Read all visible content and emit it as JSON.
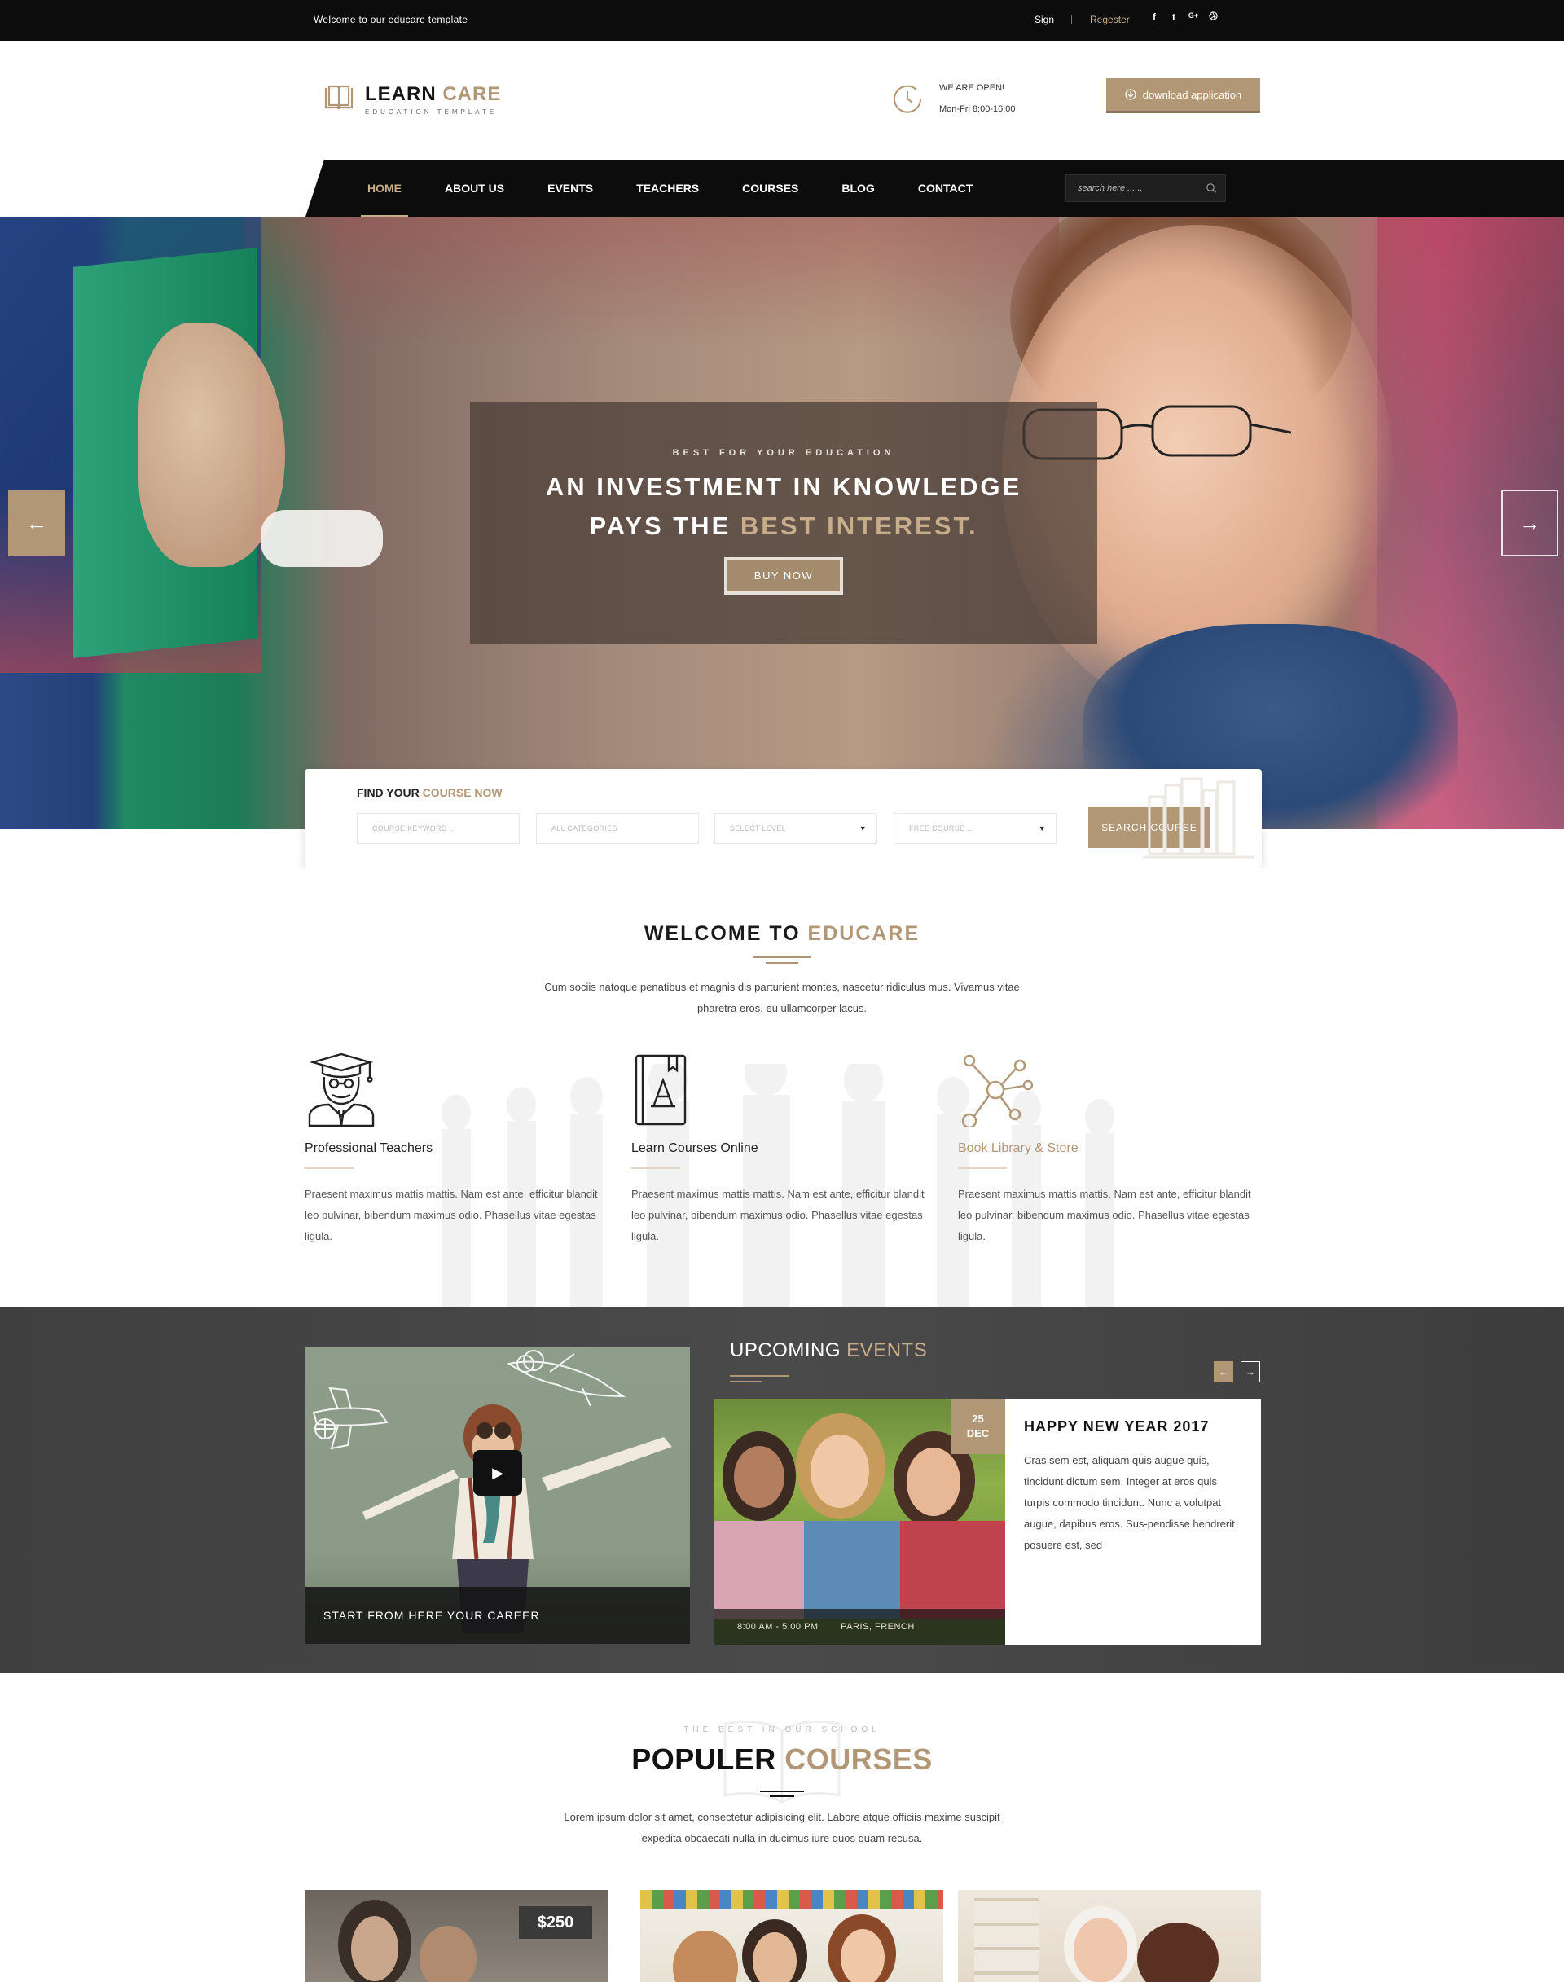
{
  "topbar": {
    "welcome": "Welcome to our educare template",
    "sign": "Sign",
    "divider": "|",
    "register": "Regester",
    "social": [
      "f",
      "t",
      "G+",
      "d"
    ]
  },
  "header": {
    "logo_word1": "LEARN",
    "logo_word2": "CARE",
    "logo_tagline": "EDUCATION TEMPLATE",
    "open_label": "WE ARE OPEN!",
    "open_hours": "Mon-Fri 8:00-16:00",
    "download_label": "download application"
  },
  "nav": {
    "items": [
      "HOME",
      "ABOUT US",
      "EVENTS",
      "TEACHERS",
      "COURSES",
      "BLOG",
      "CONTACT"
    ],
    "search_placeholder": "search here ......"
  },
  "hero": {
    "kicker": "BEST FOR YOUR EDUCATION",
    "line1": "AN INVESTMENT IN KNOWLEDGE",
    "line2_pre": "PAYS THE ",
    "line2_accent": "BEST INTEREST.",
    "button": "BUY NOW",
    "prev_arrow": "←",
    "next_arrow": "→"
  },
  "finder": {
    "title_pre": "FIND YOUR ",
    "title_accent": "COURSE NOW",
    "keyword_placeholder": "COURSE KEYWORD ...",
    "categories_placeholder": "ALL CATEGORIES",
    "level_placeholder": "SELECT LEVEL",
    "free_placeholder": "FREE COURSE ...",
    "button": "SEARCH COURSE"
  },
  "welcome": {
    "title_pre": "WELCOME TO ",
    "title_accent": "EDUCARE",
    "desc_line1": "Cum sociis natoque penatibus et magnis dis parturient montes, nascetur ridiculus mus. Vivamus vitae",
    "desc_line2": "pharetra eros, eu ullamcorper lacus.",
    "features": [
      {
        "title": "Professional Teachers",
        "icon": "teacher-icon",
        "text": "Praesent maximus mattis mattis. Nam est ante, efficitur blandit leo pulvinar, bibendum maximus odio. Phasellus vitae egestas ligula."
      },
      {
        "title": "Learn Courses Online",
        "icon": "book-icon",
        "text": "Praesent maximus mattis mattis. Nam est ante, efficitur blandit leo pulvinar, bibendum maximus odio. Phasellus vitae egestas ligula."
      },
      {
        "title": "Book Library & Store",
        "icon": "network-icon",
        "text": "Praesent maximus mattis mattis. Nam est ante, efficitur blandit leo pulvinar, bibendum maximus odio. Phasellus vitae egestas ligula."
      }
    ]
  },
  "events": {
    "video_caption": "START FROM HERE YOUR CAREER",
    "title_pre": "UPCOMING ",
    "title_accent": "EVENTS",
    "prev": "←",
    "next": "→",
    "card": {
      "day": "25",
      "month": "DEC",
      "time": "8:00 AM - 5:00 PM",
      "place": "PARIS, FRENCH",
      "title": "HAPPY NEW YEAR 2017",
      "text": "Cras sem est, aliquam quis augue quis, tincidunt dictum sem. Integer at eros quis turpis commodo tincidunt. Nunc a volutpat augue, dapibus eros. Sus-pendisse hendrerit posuere est, sed"
    }
  },
  "courses": {
    "kicker": "THE BEST IN OUR SCHOOL",
    "title_pre": "POPULER ",
    "title_accent": "COURSES",
    "desc_line1": "Lorem ipsum dolor sit amet, consectetur adipisicing elit. Labore atque officiis maxime suscipit",
    "desc_line2": "expedita obcaecati nulla in ducimus iure quos quam recusa.",
    "price": "$250"
  },
  "colors": {
    "accent": "#b29776",
    "dark": "#0c0c0c",
    "events_bg": "#464646"
  }
}
